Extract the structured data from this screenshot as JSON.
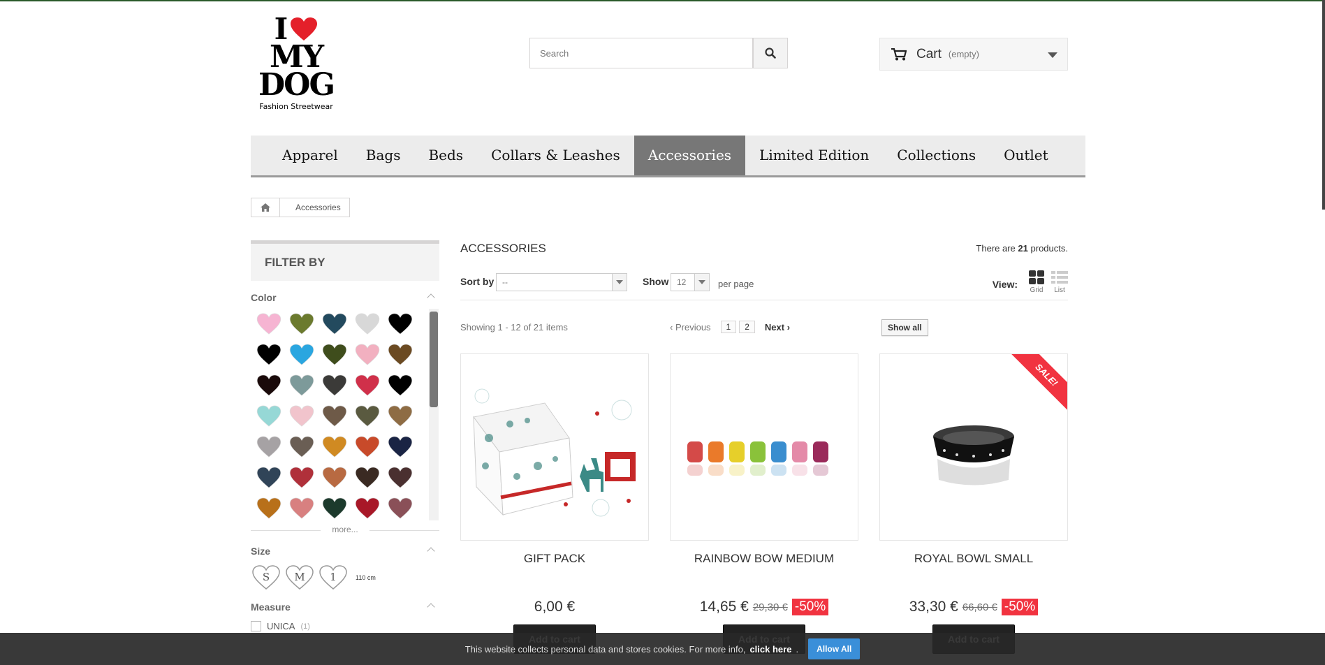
{
  "logo": {
    "line1": "I",
    "line2": "MY",
    "line3": "DOG",
    "tagline": "Fashion Streetwear"
  },
  "search": {
    "placeholder": "Search"
  },
  "cart": {
    "label": "Cart",
    "status": "(empty)"
  },
  "nav": {
    "items": [
      "Apparel",
      "Bags",
      "Beds",
      "Collars & Leashes",
      "Accessories",
      "Limited Edition",
      "Collections",
      "Outlet"
    ]
  },
  "breadcrumb": {
    "current": "Accessories"
  },
  "filter": {
    "title": "FILTER BY",
    "color_title": "Color",
    "colors": [
      "#f6b4d2",
      "#6b7a2e",
      "#234a5e",
      "#d8d8d8",
      "#000000",
      "#000000",
      "#2aa6e0",
      "#3f4d1c",
      "#f2b0c0",
      "#6b4a22",
      "#1a0a0a",
      "#7d9a9a",
      "#3b3a38",
      "#d0304a",
      "#000000",
      "#96d8d6",
      "#f1c4cc",
      "#6e5a48",
      "#5a5a40",
      "#8e6c44",
      "#a6a2a4",
      "#6a5e54",
      "#d08a22",
      "#c84a2a",
      "#1a2444",
      "#304458",
      "#b0303a",
      "#b86a42",
      "#3a2a22",
      "#4a3030",
      "#b8701a",
      "#d88080",
      "#1c3a2c",
      "#a81828",
      "#8a5058"
    ],
    "more_label": "more...",
    "size_title": "Size",
    "sizes": [
      "S",
      "M",
      "1"
    ],
    "size_extra": "110 cm",
    "measure_title": "Measure",
    "measure_option": "UNICA",
    "measure_count": "(1)"
  },
  "category": {
    "title": "ACCESSORIES",
    "count_prefix": "There are",
    "count_value": "21",
    "count_suffix": "products."
  },
  "toolbar": {
    "sort_label": "Sort by",
    "sort_value": "--",
    "show_label": "Show",
    "show_value": "12",
    "per_page": "per page",
    "view_label": "View:",
    "view_grid": "Grid",
    "view_list": "List"
  },
  "pagination": {
    "showing": "Showing 1 - 12 of 21 items",
    "previous": "Previous",
    "pages": [
      "1",
      "2"
    ],
    "next": "Next",
    "show_all": "Show all"
  },
  "products": [
    {
      "name": "GIFT PACK",
      "price": "6,00 €",
      "old_price": "",
      "discount": "",
      "sale": false,
      "add_label": "Add to cart"
    },
    {
      "name": "RAINBOW BOW MEDIUM",
      "price": "14,65 €",
      "old_price": "29,30 €",
      "discount": "-50%",
      "sale": false,
      "add_label": "Add to cart"
    },
    {
      "name": "ROYAL BOWL SMALL",
      "price": "33,30 €",
      "old_price": "66,60 €",
      "discount": "-50%",
      "sale": true,
      "sale_label": "SALE!",
      "add_label": "Add to cart"
    }
  ],
  "cookie": {
    "text": "This website collects personal data and stores cookies. For more info,",
    "link": "click here",
    "dot": ".",
    "allow": "Allow All"
  },
  "colors": {
    "accent": "#f13340",
    "nav_active": "#777777",
    "cookie_button": "#3a8fd9"
  }
}
